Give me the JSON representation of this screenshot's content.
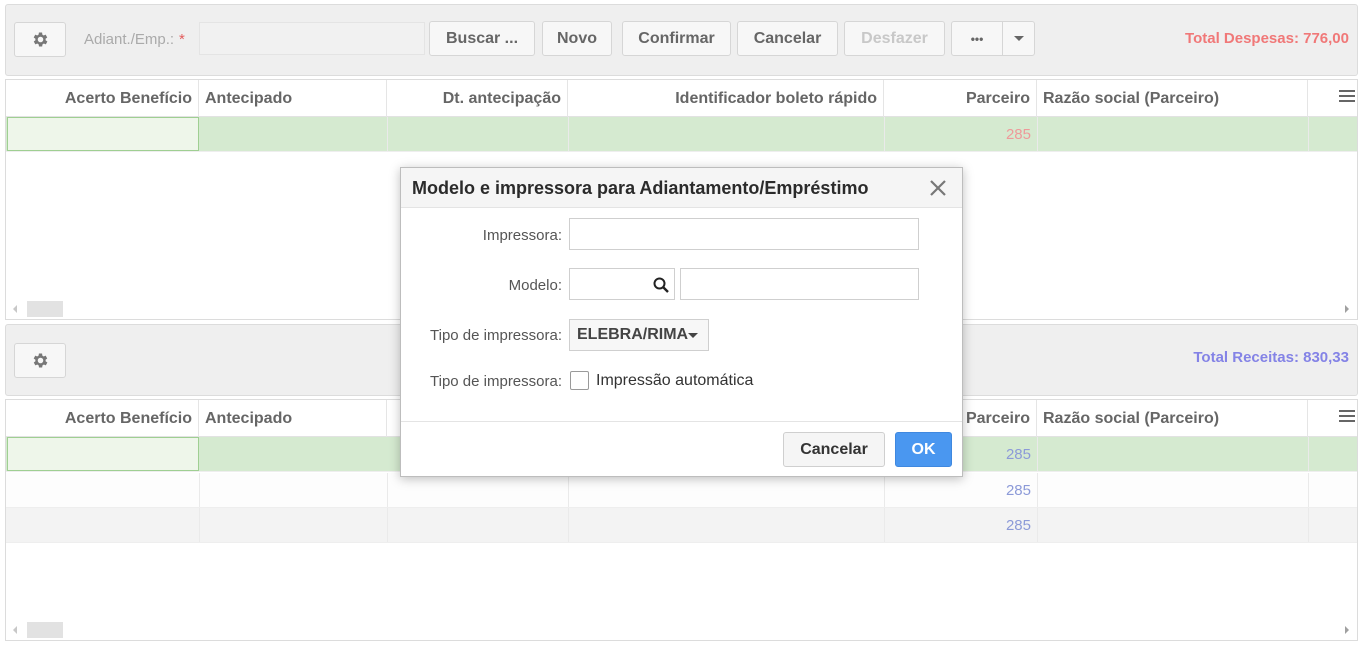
{
  "top_toolbar": {
    "settings_icon": "gear-icon",
    "adiant_label": "Adiant./Emp.:",
    "required_mark": "*",
    "adiant_value": "",
    "buttons": {
      "buscar": "Buscar ...",
      "novo": "Novo",
      "confirmar": "Confirmar",
      "cancelar": "Cancelar",
      "desfazer": "Desfazer",
      "more": "•••"
    },
    "total": "Total Despesas: 776,00"
  },
  "grid_despesas": {
    "columns": [
      "Acerto Benefício",
      "Antecipado",
      "Dt. antecipação",
      "Identificador boleto rápido",
      "Parceiro",
      "Razão social (Parceiro)"
    ],
    "rows": [
      {
        "parceiro": "285"
      }
    ]
  },
  "bottom_toolbar": {
    "settings_icon": "gear-icon",
    "total": "Total Receitas: 830,33"
  },
  "grid_receitas": {
    "columns": [
      "Acerto Benefício",
      "Antecipado",
      "Parceiro",
      "Razão social (Parceiro)"
    ],
    "rows": [
      {
        "parceiro": "285"
      },
      {
        "parceiro": "285"
      },
      {
        "parceiro": "285"
      }
    ]
  },
  "dialog": {
    "title": "Modelo e impressora para Adiantamento/Empréstimo",
    "close_icon": "close-icon",
    "impressora_label": "Impressora:",
    "impressora_value": "",
    "modelo_label": "Modelo:",
    "modelo_code": "",
    "modelo_desc": "",
    "tipo_label": "Tipo de impressora:",
    "tipo_value": "ELEBRA/RIMA",
    "tipo_label_2": "Tipo de impressora:",
    "auto_print_label": "Impressão automática",
    "auto_print_checked": false,
    "cancel_label": "Cancelar",
    "ok_label": "OK"
  },
  "colors": {
    "total_despesas": "#f07878",
    "total_receitas": "#8483e6",
    "ok_button": "#4a97f0",
    "selected_row": "#d5ead0"
  }
}
